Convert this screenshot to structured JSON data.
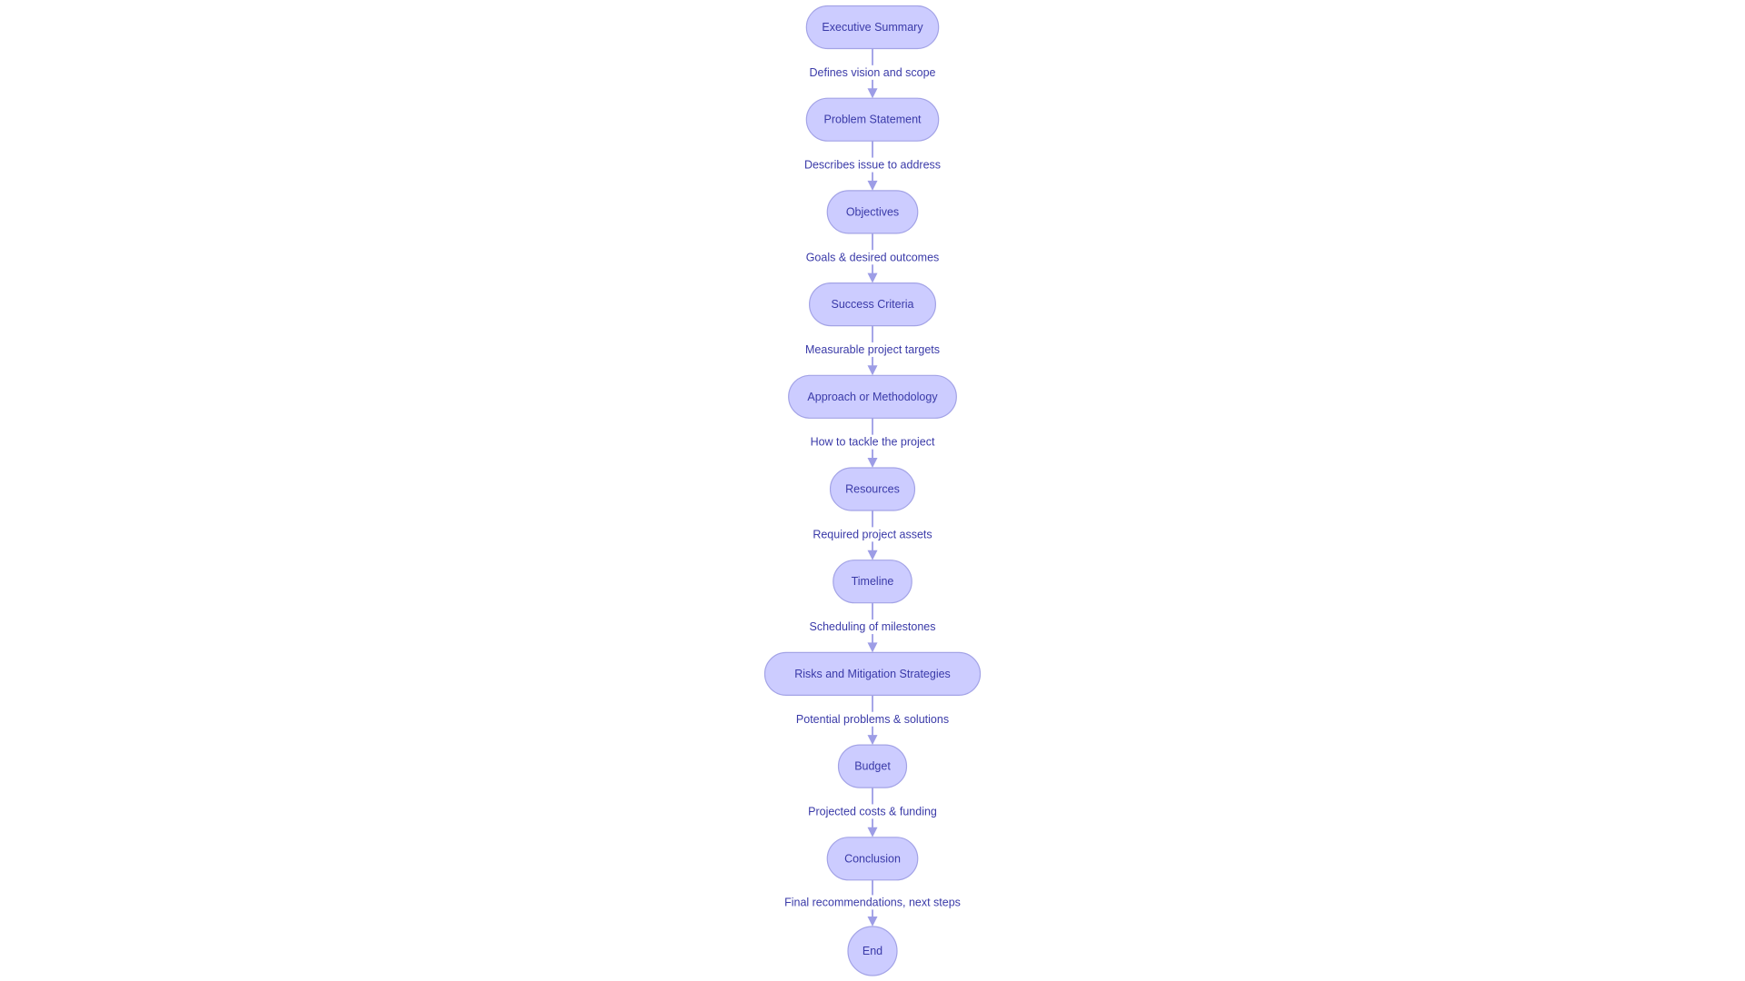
{
  "diagram": {
    "type": "flowchart",
    "direction": "top-to-bottom",
    "colors": {
      "node_fill": "#ccccff",
      "node_stroke": "#a3a3e6",
      "text": "#3a3aa8",
      "edge": "#9d9de6",
      "background": "#ffffff"
    },
    "nodes": [
      {
        "id": "executive-summary",
        "label": "Executive Summary",
        "shape": "stadium"
      },
      {
        "id": "problem-statement",
        "label": "Problem Statement",
        "shape": "stadium"
      },
      {
        "id": "objectives",
        "label": "Objectives",
        "shape": "stadium"
      },
      {
        "id": "success-criteria",
        "label": "Success Criteria",
        "shape": "stadium"
      },
      {
        "id": "approach-or-methodology",
        "label": "Approach or Methodology",
        "shape": "stadium"
      },
      {
        "id": "resources",
        "label": "Resources",
        "shape": "stadium"
      },
      {
        "id": "timeline",
        "label": "Timeline",
        "shape": "stadium"
      },
      {
        "id": "risks-and-mitigation-strategies",
        "label": "Risks and Mitigation Strategies",
        "shape": "stadium"
      },
      {
        "id": "budget",
        "label": "Budget",
        "shape": "stadium"
      },
      {
        "id": "conclusion",
        "label": "Conclusion",
        "shape": "stadium"
      },
      {
        "id": "end",
        "label": "End",
        "shape": "circle"
      }
    ],
    "edges": [
      {
        "from": "executive-summary",
        "to": "problem-statement",
        "label": "Defines vision and scope"
      },
      {
        "from": "problem-statement",
        "to": "objectives",
        "label": "Describes issue to address"
      },
      {
        "from": "objectives",
        "to": "success-criteria",
        "label": "Goals & desired outcomes"
      },
      {
        "from": "success-criteria",
        "to": "approach-or-methodology",
        "label": "Measurable project targets"
      },
      {
        "from": "approach-or-methodology",
        "to": "resources",
        "label": "How to tackle the project"
      },
      {
        "from": "resources",
        "to": "timeline",
        "label": "Required project assets"
      },
      {
        "from": "timeline",
        "to": "risks-and-mitigation-strategies",
        "label": "Scheduling of milestones"
      },
      {
        "from": "risks-and-mitigation-strategies",
        "to": "budget",
        "label": "Potential problems & solutions"
      },
      {
        "from": "budget",
        "to": "conclusion",
        "label": "Projected costs & funding"
      },
      {
        "from": "conclusion",
        "to": "end",
        "label": "Final recommendations, next steps"
      }
    ]
  }
}
